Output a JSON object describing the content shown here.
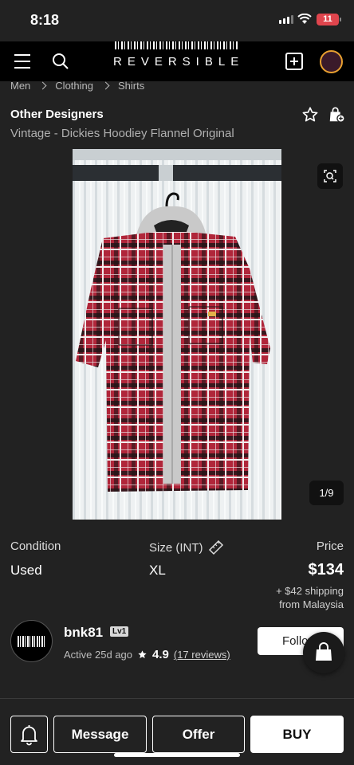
{
  "status_bar": {
    "time": "8:18",
    "battery": "11"
  },
  "header": {
    "logo_text": "REVERSIBLE",
    "avatar_text_top": "",
    "avatar_text_bottom": ""
  },
  "breadcrumb": [
    "Men",
    "Clothing",
    "Shirts"
  ],
  "product": {
    "designer": "Other Designers",
    "title": "Vintage - Dickies Hoodiey Flannel Original",
    "image_counter": "1/9",
    "image_colors": {
      "flannel": "#b0263a",
      "hood": "#c9c9c9",
      "curtain": "#eef1f2",
      "window_frame": "#2b2f33"
    }
  },
  "details": {
    "condition_label": "Condition",
    "condition_value": "Used",
    "size_label": "Size (INT)",
    "size_value": "XL",
    "price_label": "Price",
    "price_value": "$134",
    "shipping_line1": "+ $42 shipping",
    "shipping_line2": "from Malaysia"
  },
  "seller": {
    "name": "bnk81",
    "level": "Lv1",
    "active": "Active 25d ago",
    "rating": "4.9",
    "reviews": "(17 reviews)",
    "follow_label": "Follow"
  },
  "actions": {
    "message": "Message",
    "offer": "Offer",
    "buy": "BUY"
  },
  "icons": [
    "hamburger-icon",
    "search-icon",
    "add-icon",
    "star-icon",
    "bag-add-icon",
    "zoom-icon",
    "ruler-icon",
    "bell-icon",
    "bag-icon"
  ]
}
